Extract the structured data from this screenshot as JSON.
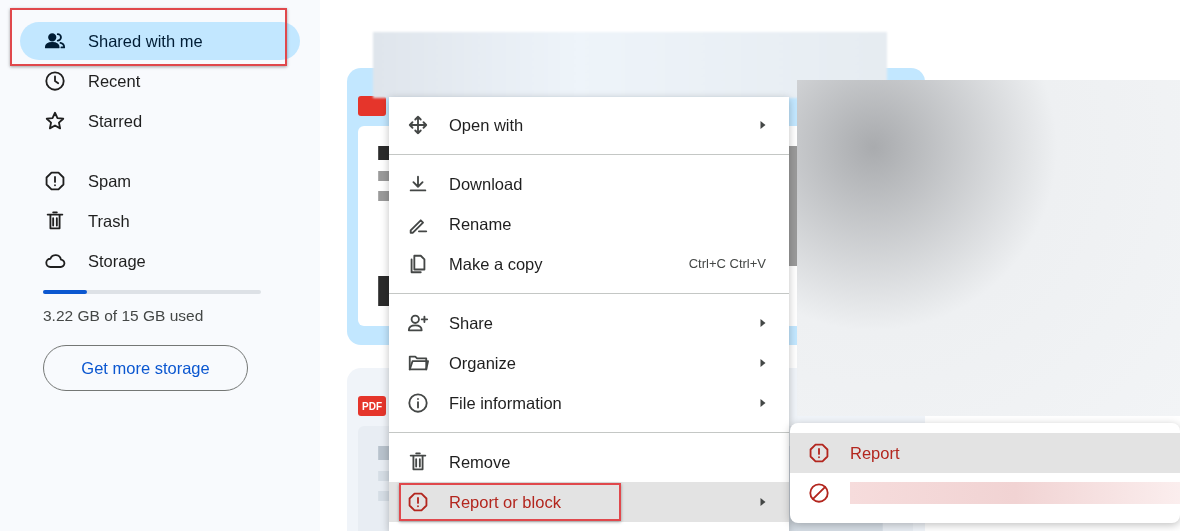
{
  "sidebar": {
    "groups": [
      [
        {
          "label": "Shared with me",
          "selected": true,
          "annotated": true
        },
        {
          "label": "Recent",
          "selected": false,
          "annotated": false
        },
        {
          "label": "Starred",
          "selected": false,
          "annotated": false
        }
      ],
      [
        {
          "label": "Spam",
          "selected": false,
          "annotated": false
        },
        {
          "label": "Trash",
          "selected": false,
          "annotated": false
        },
        {
          "label": "Storage",
          "selected": false,
          "annotated": false
        }
      ]
    ],
    "storage": {
      "level": 0.2,
      "usage": "3.22 GB of 15 GB used"
    },
    "button": "Get more storage"
  },
  "files": [
    {
      "selected": true
    },
    {
      "selected": false,
      "badge": "PDF"
    }
  ],
  "context_menu": {
    "sections": [
      [
        {
          "label": "Open with",
          "submenu": true,
          "highlighted": false,
          "danger": false,
          "annotated": false
        }
      ],
      [
        {
          "label": "Download",
          "submenu": false,
          "highlighted": false,
          "danger": false,
          "annotated": false
        },
        {
          "label": "Rename",
          "submenu": false,
          "highlighted": false,
          "danger": false,
          "annotated": false
        },
        {
          "label": "Make a copy",
          "shortcut": "Ctrl+C Ctrl+V",
          "submenu": false,
          "highlighted": false,
          "danger": false,
          "annotated": false
        }
      ],
      [
        {
          "label": "Share",
          "submenu": true,
          "highlighted": false,
          "danger": false,
          "annotated": false
        },
        {
          "label": "Organize",
          "submenu": true,
          "highlighted": false,
          "danger": false,
          "annotated": false
        },
        {
          "label": "File information",
          "submenu": true,
          "highlighted": false,
          "danger": false,
          "annotated": false
        }
      ],
      [
        {
          "label": "Remove",
          "submenu": false,
          "highlighted": false,
          "danger": false,
          "annotated": false
        },
        {
          "label": "Report or block",
          "submenu": true,
          "highlighted": true,
          "danger": true,
          "annotated": true
        }
      ]
    ]
  },
  "submenu": {
    "items": [
      {
        "kind": "text",
        "label": "Report",
        "selected": true
      },
      {
        "kind": "redacted",
        "selected": false
      }
    ]
  }
}
